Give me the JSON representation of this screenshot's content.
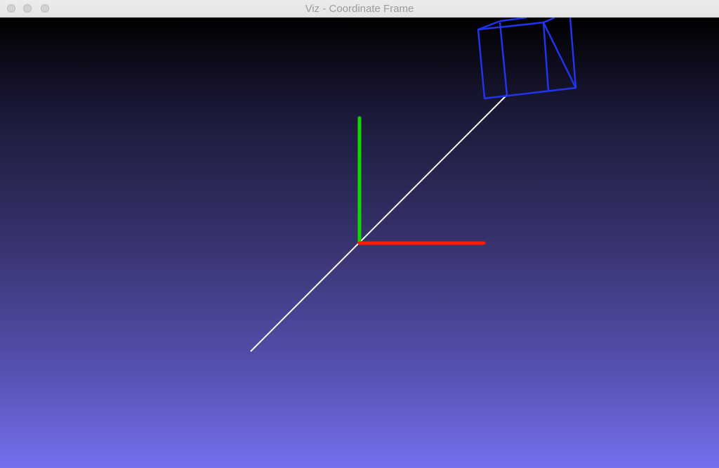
{
  "window": {
    "title": "Viz - Coordinate Frame"
  },
  "colors": {
    "x_axis": "#ff1a00",
    "y_axis": "#16d400",
    "line": "#ffffff",
    "camera": "#2233ee"
  },
  "icons": [
    "close-button",
    "minimize-button",
    "zoom-button"
  ]
}
